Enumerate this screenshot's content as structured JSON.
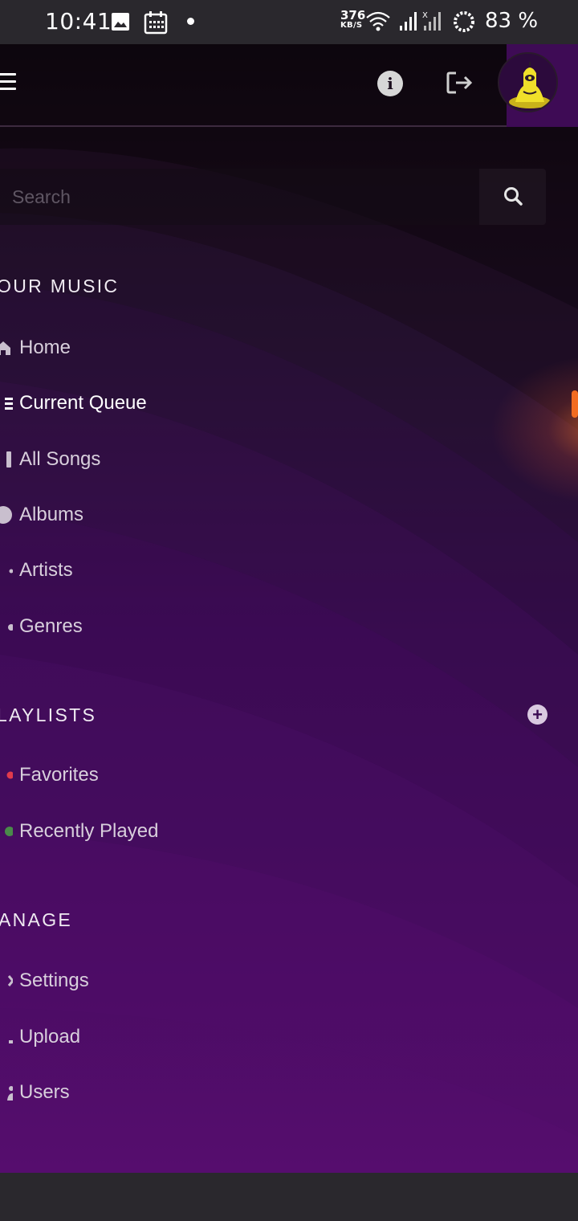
{
  "status_bar": {
    "time": "10:41",
    "net_speed": "376",
    "net_unit": "KB/S",
    "battery": "83 %"
  },
  "header": {
    "icons": [
      "menu-icon",
      "info-icon",
      "logout-icon",
      "avatar"
    ]
  },
  "search": {
    "placeholder": "Search"
  },
  "sections": {
    "your_music": {
      "title": "OUR MUSIC",
      "items": [
        {
          "label": "Home",
          "icon": "home-icon"
        },
        {
          "label": "Current Queue",
          "icon": "list-icon"
        },
        {
          "label": "All Songs",
          "icon": "music-icon"
        },
        {
          "label": "Albums",
          "icon": "disc-icon"
        },
        {
          "label": "Artists",
          "icon": "microphone-icon"
        },
        {
          "label": "Genres",
          "icon": "tag-icon"
        }
      ]
    },
    "playlists": {
      "title": "LAYLISTS",
      "items": [
        {
          "label": "Favorites",
          "icon": "heart-icon",
          "color": "#e23b4c"
        },
        {
          "label": "Recently Played",
          "icon": "history-icon",
          "color": "#4a8a4a"
        }
      ]
    },
    "manage": {
      "title": "ANAGE",
      "items": [
        {
          "label": "Settings",
          "icon": "wrench-icon"
        },
        {
          "label": "Upload",
          "icon": "upload-icon"
        },
        {
          "label": "Users",
          "icon": "users-icon"
        }
      ]
    }
  },
  "colors": {
    "accent": "#f26c22",
    "brand_purple": "#3e0b55",
    "status_bar": "#2a282d"
  }
}
